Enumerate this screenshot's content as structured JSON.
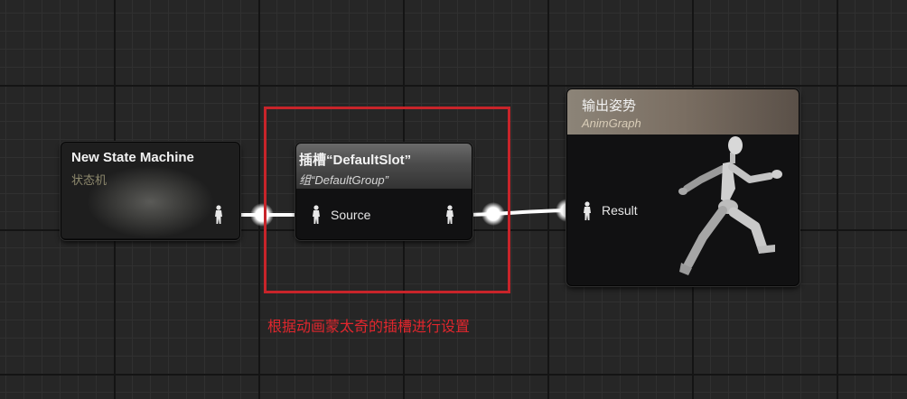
{
  "nodes": {
    "state_machine": {
      "title": "New State Machine",
      "subtitle": "状态机"
    },
    "slot": {
      "title": "插槽“DefaultSlot”",
      "subtitle": "组“DefaultGroup”",
      "input_pin_label": "Source"
    },
    "output_pose": {
      "title": "输出姿势",
      "subtitle": "AnimGraph",
      "input_pin_label": "Result"
    }
  },
  "annotation": {
    "text": "根据动画蒙太奇的插槽进行设置",
    "color": "#e0262d"
  },
  "colors": {
    "background": "#262626",
    "node_body": "#111112",
    "wire": "#ffffff",
    "subtitle_state_machine": "#8f8a6e",
    "subtitle_slot": "#d6d6d6",
    "subtitle_output": "#d9cdb8"
  },
  "icons": [
    "pose-pin-icon",
    "running-mannequin-icon"
  ]
}
